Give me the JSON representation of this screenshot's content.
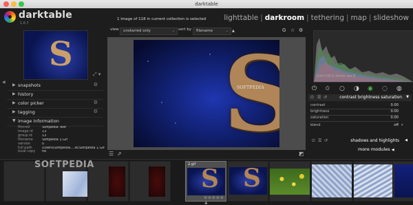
{
  "window": {
    "title": "darktable"
  },
  "logo": {
    "name": "darktable",
    "version": "1.6.7"
  },
  "header": {
    "collection_status": "1 image of 118 in current collection is selected",
    "views": [
      "lighttable",
      "darkroom",
      "tethering",
      "map",
      "slideshow"
    ],
    "active_view": "darkroom"
  },
  "toolbar": {
    "view_label": "view",
    "view_value": "unstarred only",
    "sort_label": "sort by",
    "sort_value": "filename",
    "sort_dir": "▲"
  },
  "left_panel": {
    "sections": [
      {
        "label": "snapshots"
      },
      {
        "label": "history"
      },
      {
        "label": "color picker"
      },
      {
        "label": "tagging"
      },
      {
        "label": "image information"
      }
    ],
    "image_information": [
      {
        "key": "filmroll",
        "value": "Softpedia Test"
      },
      {
        "key": "image id",
        "value": "13"
      },
      {
        "key": "group id",
        "value": "13"
      },
      {
        "key": "filename",
        "value": "Softpedia 1.Gif"
      },
      {
        "key": "version",
        "value": "0"
      },
      {
        "key": "full path",
        "value": "/Users/Softpedia....st/Softpedia 1.Gif"
      },
      {
        "key": "local copy",
        "value": "no"
      }
    ]
  },
  "image": {
    "brand_text": "SOFTPEDIA"
  },
  "histogram": {
    "readout": "1/inf f/0.0 0mm iso 0"
  },
  "module": {
    "title": "contrast brightness saturation",
    "sliders": [
      {
        "label": "contrast",
        "value": "0.00"
      },
      {
        "label": "brightness",
        "value": "0.00"
      },
      {
        "label": "saturation",
        "value": "0.00"
      }
    ],
    "blend_label": "blend",
    "blend_value": "off",
    "next_module": "shadows and highlights",
    "more_modules": "more modules"
  },
  "filmstrip": {
    "watermark": "SOFTPEDIA",
    "selected_label": "2.gif"
  },
  "colors": {
    "background": "#1d1d1d",
    "panel": "#2a2a2a",
    "accent_green": "#4caf50"
  }
}
